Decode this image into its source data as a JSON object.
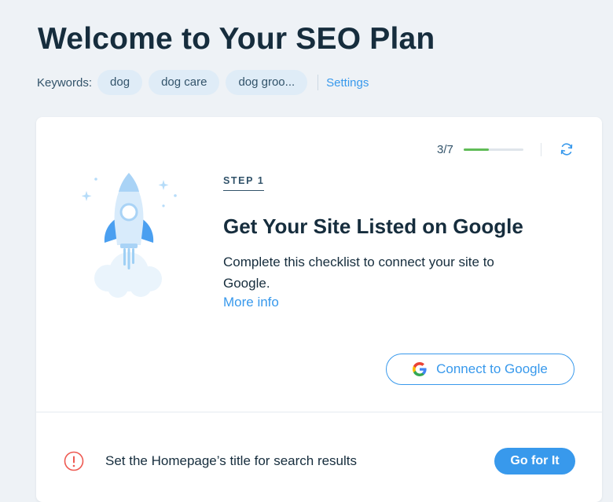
{
  "header": {
    "title": "Welcome to Your SEO Plan",
    "keywords_label": "Keywords:",
    "keywords": [
      "dog",
      "dog care",
      "dog groo..."
    ],
    "settings_label": "Settings"
  },
  "progress": {
    "text": "3/7",
    "completed": 3,
    "total": 7
  },
  "step": {
    "label": "STEP 1",
    "title": "Get Your Site Listed on Google",
    "description": "Complete this checklist to connect your site to Google.",
    "more_info_label": "More info",
    "connect_button_label": "Connect to Google"
  },
  "task": {
    "text": "Set the Homepage’s title for search results",
    "button_label": "Go for It"
  },
  "colors": {
    "accent": "#3899ec",
    "progress_fill": "#60bc57",
    "alert": "#ee5951",
    "heading": "#162d3d",
    "background": "#eef2f6"
  },
  "icons": [
    "refresh-icon",
    "rocket-icon",
    "google-icon",
    "alert-icon"
  ]
}
